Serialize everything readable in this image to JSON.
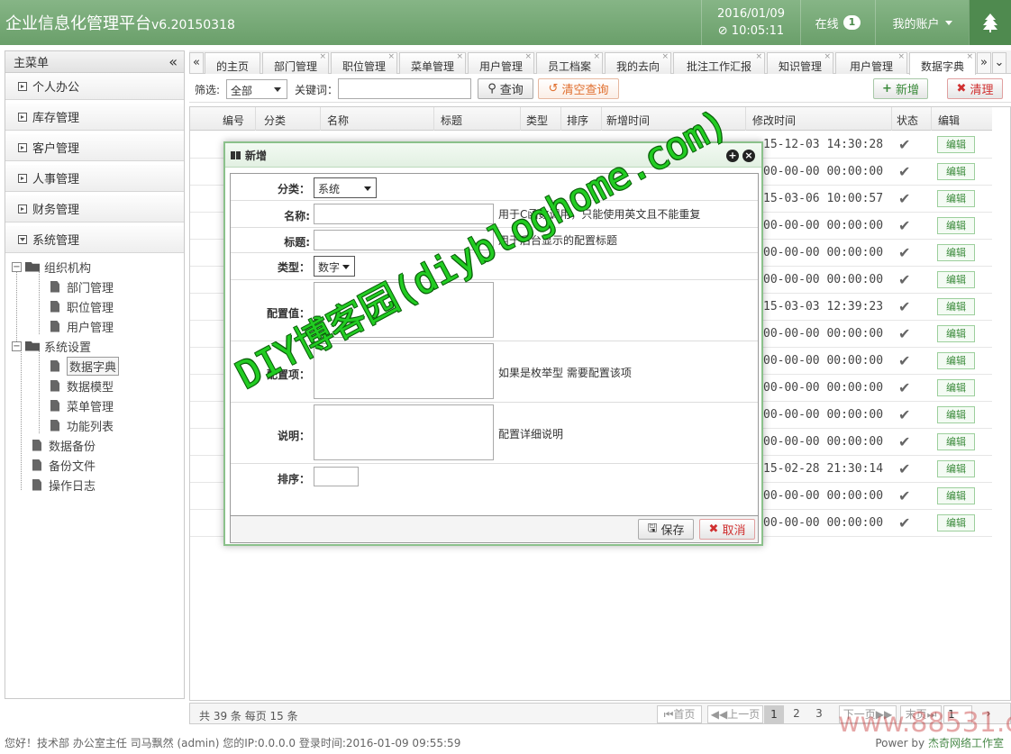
{
  "header": {
    "title": "企业信息化管理平台",
    "version": "v6.20150318",
    "date": "2016/01/09",
    "time": "⊘ 10:05:11",
    "online_label": "在线",
    "online_count": "1",
    "account_label": "我的账户"
  },
  "sidebar": {
    "title": "主菜单",
    "collapse": "«",
    "items": [
      {
        "label": "个人办公"
      },
      {
        "label": "库存管理"
      },
      {
        "label": "客户管理"
      },
      {
        "label": "人事管理"
      },
      {
        "label": "财务管理"
      },
      {
        "label": "系统管理"
      }
    ],
    "tree": {
      "org": "组织机构",
      "org_children": [
        "部门管理",
        "职位管理",
        "用户管理"
      ],
      "sys": "系统设置",
      "sys_children": [
        "数据字典",
        "数据模型",
        "菜单管理",
        "功能列表"
      ],
      "others": [
        "数据备份",
        "备份文件",
        "操作日志"
      ]
    }
  },
  "tabs": [
    "的主页",
    "部门管理",
    "职位管理",
    "菜单管理",
    "用户管理",
    "员工档案",
    "我的去向",
    "批注工作汇报",
    "知识管理",
    "用户管理",
    "数据字典"
  ],
  "toolbar": {
    "filter_label": "筛选:",
    "filter_value": "全部",
    "keyword_label": "关键词：",
    "search_btn": "查询",
    "clear_btn": "清空查询",
    "add_btn": "新增",
    "clean_btn": "清理"
  },
  "grid": {
    "columns": [
      "编号",
      "分类",
      "名称",
      "标题",
      "类型",
      "排序",
      "新增时间",
      "修改时间",
      "状态",
      "编辑"
    ],
    "rows": [
      {
        "modified": "15-12-03 14:30:28",
        "edit": "编辑"
      },
      {
        "modified": "00-00-00 00:00:00",
        "edit": "编辑"
      },
      {
        "modified": "15-03-06 10:00:57",
        "edit": "编辑"
      },
      {
        "modified": "00-00-00 00:00:00",
        "edit": "编辑"
      },
      {
        "modified": "00-00-00 00:00:00",
        "edit": "编辑"
      },
      {
        "modified": "00-00-00 00:00:00",
        "edit": "编辑"
      },
      {
        "modified": "15-03-03 12:39:23",
        "edit": "编辑"
      },
      {
        "modified": "00-00-00 00:00:00",
        "edit": "编辑"
      },
      {
        "modified": "00-00-00 00:00:00",
        "edit": "编辑"
      },
      {
        "modified": "00-00-00 00:00:00",
        "edit": "编辑"
      },
      {
        "modified": "00-00-00 00:00:00",
        "edit": "编辑"
      },
      {
        "modified": "00-00-00 00:00:00",
        "edit": "编辑"
      },
      {
        "modified": "15-02-28 21:30:14",
        "edit": "编辑"
      },
      {
        "modified": "00-00-00 00:00:00",
        "edit": "编辑"
      },
      {
        "modified": "00-00-00 00:00:00",
        "edit": "编辑"
      }
    ]
  },
  "pager": {
    "info": "共 39 条 每页 15 条",
    "first": "首页",
    "prev": "上一页",
    "pages": [
      "1",
      "2",
      "3"
    ],
    "next": "下一页",
    "last": "末页",
    "page_input": "1"
  },
  "dialog": {
    "title": "新增",
    "fields": {
      "category_label": "分类：",
      "category_value": "系统",
      "name_label": "名称:",
      "name_help": "用于C函数调用，只能使用英文且不能重复",
      "title_label": "标题:",
      "title_help": "用于后台显示的配置标题",
      "type_label": "类型：",
      "type_value": "数字",
      "value_label": "配置值：",
      "items_label": "配置项：",
      "items_help": "如果是枚举型 需要配置该项",
      "desc_label": "说明：",
      "desc_help": "配置详细说明",
      "sort_label": "排序："
    },
    "save_btn": "保存",
    "cancel_btn": "取消"
  },
  "status": {
    "left": "您好！技术部 办公室主任 司马飘然 (admin) 您的IP:0.0.0.0 登录时间:2016-01-09 09:55:59",
    "right_prefix": "Power by",
    "right_brand": "杰奇网络工作室"
  },
  "watermark": "DIY博客园(diybloghome.com)",
  "watermark2": "www.88531.cn"
}
